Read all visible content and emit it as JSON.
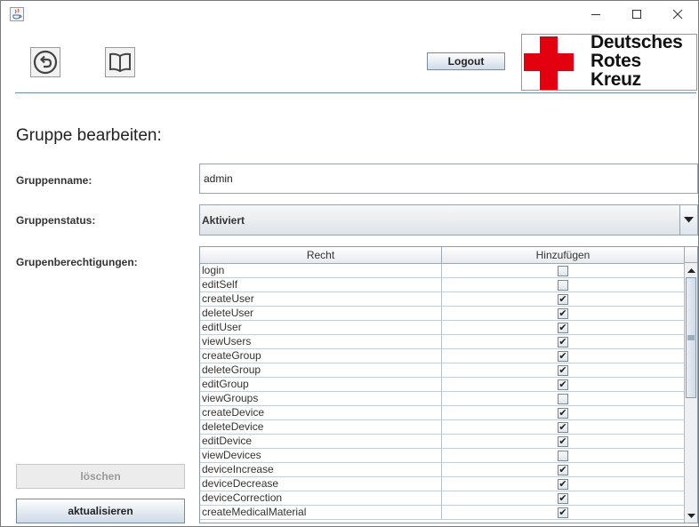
{
  "window": {
    "minimize_glyph": "—",
    "maximize_glyph": "☐",
    "close_glyph": "✕"
  },
  "toolbar": {
    "back_icon": "back-arrow-icon",
    "help_icon": "book-icon",
    "logout_label": "Logout"
  },
  "logo": {
    "line1": "Deutsches",
    "line2": "Rotes",
    "line3": "Kreuz",
    "color": "#e3000f"
  },
  "page": {
    "title": "Gruppe bearbeiten:"
  },
  "form": {
    "name_label": "Gruppenname:",
    "name_value": "admin",
    "status_label": "Gruppenstatus:",
    "status_value": "Aktiviert",
    "permissions_label": "Grupenberechtigungen:"
  },
  "table": {
    "columns": [
      "Recht",
      "Hinzufügen"
    ],
    "rows": [
      {
        "name": "login",
        "checked": false
      },
      {
        "name": "editSelf",
        "checked": false
      },
      {
        "name": "createUser",
        "checked": true
      },
      {
        "name": "deleteUser",
        "checked": true
      },
      {
        "name": "editUser",
        "checked": true
      },
      {
        "name": "viewUsers",
        "checked": true
      },
      {
        "name": "createGroup",
        "checked": true
      },
      {
        "name": "deleteGroup",
        "checked": true
      },
      {
        "name": "editGroup",
        "checked": true
      },
      {
        "name": "viewGroups",
        "checked": false
      },
      {
        "name": "createDevice",
        "checked": true
      },
      {
        "name": "deleteDevice",
        "checked": true
      },
      {
        "name": "editDevice",
        "checked": true
      },
      {
        "name": "viewDevices",
        "checked": false
      },
      {
        "name": "deviceIncrease",
        "checked": true
      },
      {
        "name": "deviceDecrease",
        "checked": true
      },
      {
        "name": "deviceCorrection",
        "checked": true
      },
      {
        "name": "createMedicalMaterial",
        "checked": true
      }
    ]
  },
  "actions": {
    "delete_label": "löschen",
    "update_label": "aktualisieren"
  },
  "colors": {
    "accent": "#6f8da3",
    "button_gradient_bottom": "#cddbe9"
  }
}
